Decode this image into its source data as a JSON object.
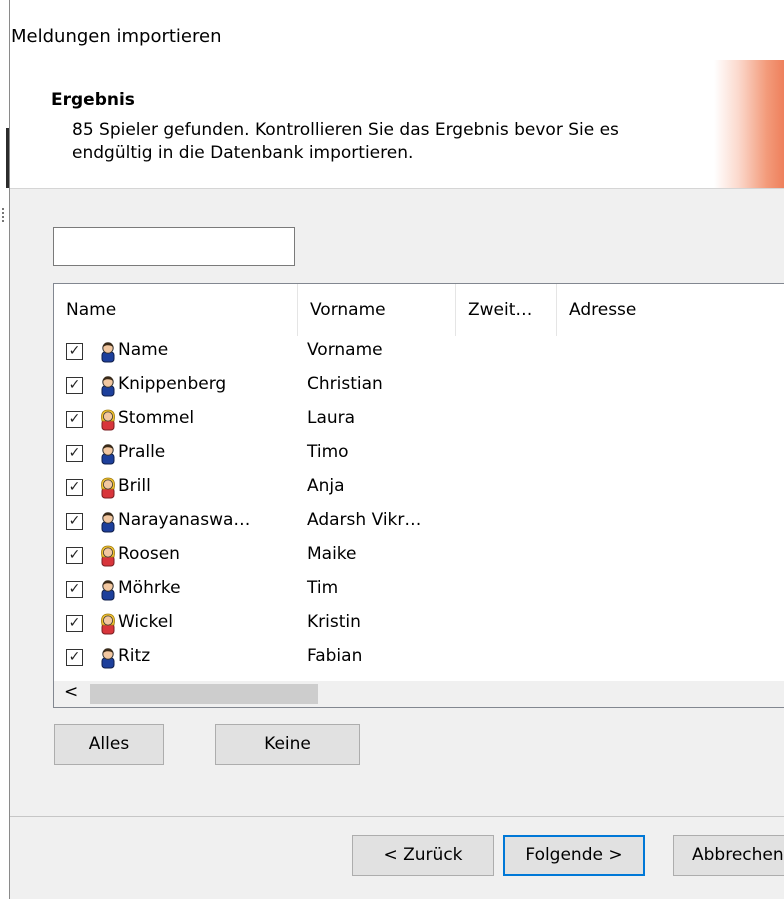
{
  "dialog": {
    "title": "Meldungen importieren"
  },
  "header": {
    "title": "Ergebnis",
    "text": "85 Spieler gefunden. Kontrollieren Sie das Ergebnis bevor Sie es endgültig in die Datenbank importieren."
  },
  "filter": {
    "value": ""
  },
  "list": {
    "columns": [
      "Name",
      "Vorname",
      "Zweit…",
      "Adresse"
    ],
    "rows": [
      {
        "name": "Name",
        "first": "Vorname",
        "gender": "male",
        "checked": true
      },
      {
        "name": "Knippenberg",
        "first": "Christian",
        "gender": "male",
        "checked": true
      },
      {
        "name": "Stommel",
        "first": "Laura",
        "gender": "female",
        "checked": true
      },
      {
        "name": "Pralle",
        "first": "Timo",
        "gender": "male",
        "checked": true
      },
      {
        "name": "Brill",
        "first": "Anja",
        "gender": "female",
        "checked": true
      },
      {
        "name": "Narayanaswa…",
        "first": "Adarsh Vikr…",
        "gender": "male",
        "checked": true
      },
      {
        "name": "Roosen",
        "first": "Maike",
        "gender": "female",
        "checked": true
      },
      {
        "name": "Möhrke",
        "first": "Tim",
        "gender": "male",
        "checked": true
      },
      {
        "name": "Wickel",
        "first": "Kristin",
        "gender": "female",
        "checked": true
      },
      {
        "name": "Ritz",
        "first": "Fabian",
        "gender": "male",
        "checked": true
      }
    ],
    "scroll_left_glyph": "<"
  },
  "buttons": {
    "all": "Alles",
    "none": "Keine",
    "back": "< Zurück",
    "next": "Folgende >",
    "cancel": "Abbrechen"
  },
  "icons": {
    "male": "male-person-icon",
    "female": "female-person-icon",
    "checkbox": "checkbox-checked-icon"
  },
  "colors": {
    "accent": "#0078d7",
    "male_body": "#1d3f9b",
    "female_body": "#d8353b",
    "female_hair": "#f1c232"
  }
}
